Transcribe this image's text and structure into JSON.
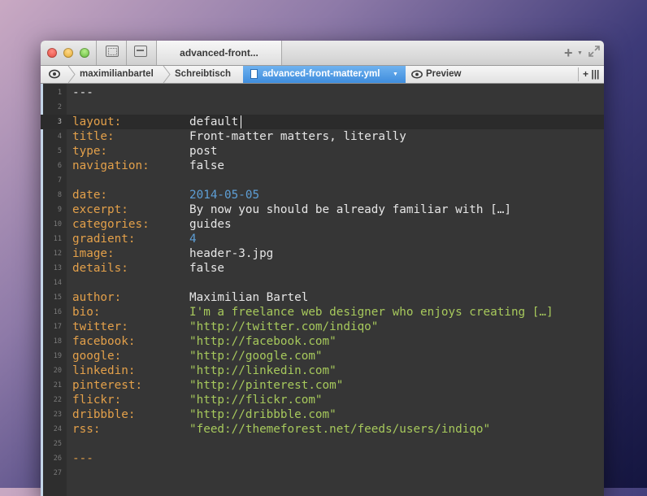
{
  "window": {
    "tab_title": "advanced-front..."
  },
  "pathbar": {
    "crumbs": [
      "maximilianbartel",
      "Schreibtisch",
      "advanced-front-matter.yml"
    ],
    "preview_label": "Preview",
    "split_label": "+ |||"
  },
  "colors": {
    "key": "#e3a04a",
    "string": "#a7c95c",
    "number": "#5e9fd6",
    "text": "#e6e6e6",
    "background": "#363636",
    "active_crumb": "#4a95e2"
  },
  "editor": {
    "current_line": 3,
    "lines": [
      {
        "n": "1",
        "key": "",
        "value": "---",
        "kind": "dash"
      },
      {
        "n": "2",
        "key": "",
        "value": "",
        "kind": "text"
      },
      {
        "n": "3",
        "key": "layout:",
        "value": "default",
        "kind": "text"
      },
      {
        "n": "4",
        "key": "title:",
        "value": "Front-matter matters, literally",
        "kind": "text"
      },
      {
        "n": "5",
        "key": "type:",
        "value": "post",
        "kind": "text"
      },
      {
        "n": "6",
        "key": "navigation:",
        "value": "false",
        "kind": "text"
      },
      {
        "n": "7",
        "key": "",
        "value": "",
        "kind": "text"
      },
      {
        "n": "8",
        "key": "date:",
        "value": "2014-05-05",
        "kind": "number"
      },
      {
        "n": "9",
        "key": "excerpt:",
        "value": "By now you should be already familiar with […]",
        "kind": "text"
      },
      {
        "n": "10",
        "key": "categories:",
        "value": "guides",
        "kind": "text"
      },
      {
        "n": "11",
        "key": "gradient:",
        "value": "4",
        "kind": "number"
      },
      {
        "n": "12",
        "key": "image:",
        "value": "header-3.jpg",
        "kind": "text"
      },
      {
        "n": "13",
        "key": "details:",
        "value": "false",
        "kind": "text"
      },
      {
        "n": "14",
        "key": "",
        "value": "",
        "kind": "text"
      },
      {
        "n": "15",
        "key": "author:",
        "value": "Maximilian Bartel",
        "kind": "text"
      },
      {
        "n": "16",
        "key": "bio:",
        "value": "I'm a freelance web designer who enjoys creating […]",
        "kind": "string"
      },
      {
        "n": "17",
        "key": "twitter:",
        "value": "\"http://twitter.com/indiqo\"",
        "kind": "string"
      },
      {
        "n": "18",
        "key": "facebook:",
        "value": "\"http://facebook.com\"",
        "kind": "string"
      },
      {
        "n": "19",
        "key": "google:",
        "value": "\"http://google.com\"",
        "kind": "string"
      },
      {
        "n": "20",
        "key": "linkedin:",
        "value": "\"http://linkedin.com\"",
        "kind": "string"
      },
      {
        "n": "21",
        "key": "pinterest:",
        "value": "\"http://pinterest.com\"",
        "kind": "string"
      },
      {
        "n": "22",
        "key": "flickr:",
        "value": "\"http://flickr.com\"",
        "kind": "string"
      },
      {
        "n": "23",
        "key": "dribbble:",
        "value": "\"http://dribbble.com\"",
        "kind": "string"
      },
      {
        "n": "24",
        "key": "rss:",
        "value": "\"feed://themeforest.net/feeds/users/indiqo\"",
        "kind": "string"
      },
      {
        "n": "25",
        "key": "",
        "value": "",
        "kind": "text"
      },
      {
        "n": "26",
        "key": "",
        "value": "---",
        "kind": "dash-last"
      },
      {
        "n": "27",
        "key": "",
        "value": "",
        "kind": "text"
      }
    ]
  }
}
